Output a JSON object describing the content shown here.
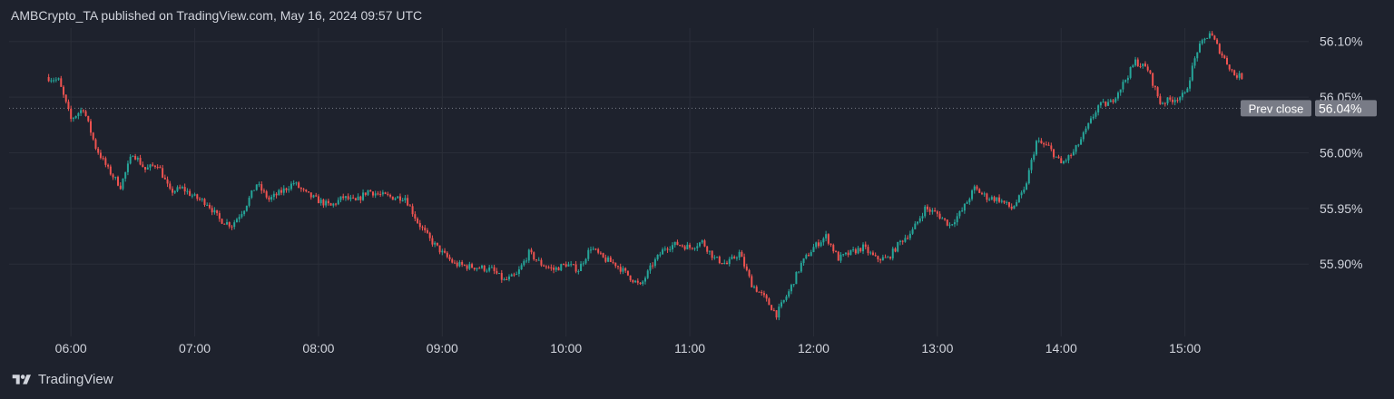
{
  "header": {
    "published_text": "AMBCrypto_TA published on TradingView.com, May 16, 2024 09:57 UTC"
  },
  "footer": {
    "brand": "TradingView"
  },
  "colors": {
    "up": "#26a69a",
    "down": "#ef5350",
    "background": "#1e222d",
    "grid": "#2a2e39",
    "text": "#d1d4dc"
  },
  "chart_data": {
    "type": "line",
    "series": [
      {
        "values": [
          [
            5.8,
            56.068
          ],
          [
            5.9,
            56.065
          ],
          [
            6.0,
            56.03
          ],
          [
            6.1,
            56.04
          ],
          [
            6.2,
            56.005
          ],
          [
            6.3,
            55.985
          ],
          [
            6.4,
            55.97
          ],
          [
            6.5,
            56.0
          ],
          [
            6.6,
            55.985
          ],
          [
            6.7,
            55.99
          ],
          [
            6.8,
            55.965
          ],
          [
            6.9,
            55.968
          ],
          [
            7.0,
            55.96
          ],
          [
            7.1,
            55.955
          ],
          [
            7.2,
            55.94
          ],
          [
            7.3,
            55.935
          ],
          [
            7.4,
            55.95
          ],
          [
            7.5,
            55.972
          ],
          [
            7.6,
            55.958
          ],
          [
            7.7,
            55.965
          ],
          [
            7.8,
            55.973
          ],
          [
            7.9,
            55.963
          ],
          [
            8.0,
            55.957
          ],
          [
            8.1,
            55.952
          ],
          [
            8.2,
            55.96
          ],
          [
            8.3,
            55.956
          ],
          [
            8.4,
            55.966
          ],
          [
            8.5,
            55.962
          ],
          [
            8.6,
            55.96
          ],
          [
            8.7,
            55.96
          ],
          [
            8.8,
            55.938
          ],
          [
            8.9,
            55.922
          ],
          [
            9.0,
            55.91
          ],
          [
            9.1,
            55.9
          ],
          [
            9.2,
            55.898
          ],
          [
            9.3,
            55.897
          ],
          [
            9.4,
            55.895
          ],
          [
            9.5,
            55.885
          ],
          [
            9.6,
            55.89
          ],
          [
            9.7,
            55.91
          ],
          [
            9.8,
            55.9
          ],
          [
            9.9,
            55.895
          ],
          [
            10.0,
            55.9
          ],
          [
            10.1,
            55.895
          ],
          [
            10.2,
            55.915
          ],
          [
            10.3,
            55.905
          ],
          [
            10.4,
            55.9
          ],
          [
            10.5,
            55.89
          ],
          [
            10.6,
            55.88
          ],
          [
            10.7,
            55.9
          ],
          [
            10.8,
            55.915
          ],
          [
            10.9,
            55.918
          ],
          [
            11.0,
            55.915
          ],
          [
            11.1,
            55.92
          ],
          [
            11.2,
            55.905
          ],
          [
            11.3,
            55.9
          ],
          [
            11.4,
            55.91
          ],
          [
            11.5,
            55.882
          ],
          [
            11.6,
            55.87
          ],
          [
            11.7,
            55.855
          ],
          [
            11.8,
            55.875
          ],
          [
            11.9,
            55.9
          ],
          [
            12.0,
            55.915
          ],
          [
            12.1,
            55.925
          ],
          [
            12.2,
            55.905
          ],
          [
            12.3,
            55.91
          ],
          [
            12.4,
            55.915
          ],
          [
            12.5,
            55.905
          ],
          [
            12.6,
            55.905
          ],
          [
            12.7,
            55.92
          ],
          [
            12.8,
            55.93
          ],
          [
            12.9,
            55.95
          ],
          [
            13.0,
            55.945
          ],
          [
            13.1,
            55.935
          ],
          [
            13.2,
            55.948
          ],
          [
            13.3,
            55.968
          ],
          [
            13.4,
            55.96
          ],
          [
            13.5,
            55.958
          ],
          [
            13.6,
            55.95
          ],
          [
            13.7,
            55.965
          ],
          [
            13.8,
            56.01
          ],
          [
            13.9,
            56.005
          ],
          [
            14.0,
            55.99
          ],
          [
            14.1,
            56.0
          ],
          [
            14.2,
            56.02
          ],
          [
            14.3,
            56.042
          ],
          [
            14.4,
            56.045
          ],
          [
            14.5,
            56.062
          ],
          [
            14.6,
            56.082
          ],
          [
            14.7,
            56.075
          ],
          [
            14.8,
            56.045
          ],
          [
            14.9,
            56.048
          ],
          [
            15.0,
            56.052
          ],
          [
            15.1,
            56.092
          ],
          [
            15.2,
            56.108
          ],
          [
            15.3,
            56.088
          ],
          [
            15.4,
            56.07
          ],
          [
            15.47,
            56.068
          ]
        ]
      }
    ],
    "x_ticks": [
      {
        "value": 6,
        "label": "06:00"
      },
      {
        "value": 7,
        "label": "07:00"
      },
      {
        "value": 8,
        "label": "08:00"
      },
      {
        "value": 9,
        "label": "09:00"
      },
      {
        "value": 10,
        "label": "10:00"
      },
      {
        "value": 11,
        "label": "11:00"
      },
      {
        "value": 12,
        "label": "12:00"
      },
      {
        "value": 13,
        "label": "13:00"
      },
      {
        "value": 14,
        "label": "14:00"
      },
      {
        "value": 15,
        "label": "15:00"
      }
    ],
    "y_ticks": [
      {
        "value": 56.1,
        "label": "56.10%"
      },
      {
        "value": 56.05,
        "label": "56.05%"
      },
      {
        "value": 56.0,
        "label": "56.00%"
      },
      {
        "value": 55.95,
        "label": "55.95%"
      },
      {
        "value": 55.9,
        "label": "55.90%"
      }
    ],
    "xlim": [
      5.5,
      16.0
    ],
    "ylim": [
      55.835,
      56.112
    ],
    "prev_close": {
      "value": 56.04,
      "tag": "Prev close",
      "label": "56.04%"
    },
    "grid": true,
    "axis_position": "right"
  }
}
